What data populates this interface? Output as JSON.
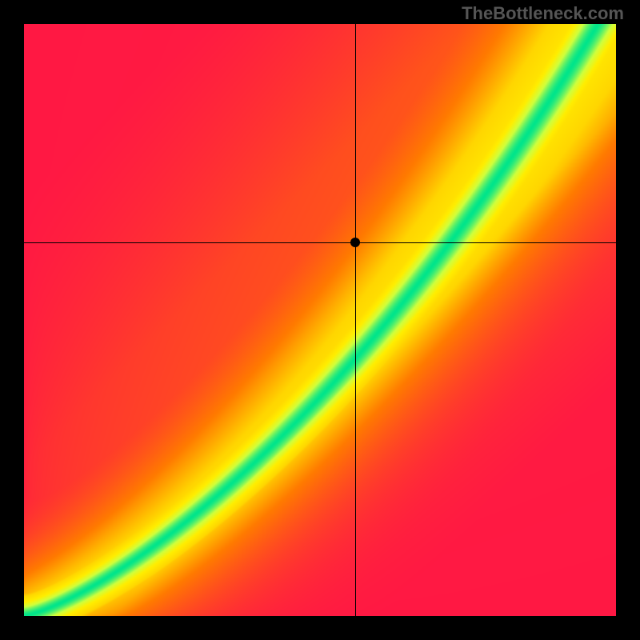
{
  "watermark": "TheBottleneck.com",
  "chart_data": {
    "type": "heatmap",
    "title": "",
    "xlabel": "",
    "ylabel": "",
    "xlim": [
      0,
      100
    ],
    "ylim": [
      0,
      100
    ],
    "crosshair": {
      "x": 56,
      "y": 63
    },
    "marker": {
      "x": 56,
      "y": 63
    },
    "color_stops": [
      {
        "value": 0.0,
        "color": "#ff1744"
      },
      {
        "value": 0.35,
        "color": "#ff7a00"
      },
      {
        "value": 0.55,
        "color": "#ffd600"
      },
      {
        "value": 0.72,
        "color": "#ffee00"
      },
      {
        "value": 0.85,
        "color": "#cfff3d"
      },
      {
        "value": 1.0,
        "color": "#00e58b"
      }
    ],
    "ridge_a": 1.05,
    "ridge_b": 0.6,
    "ridge_width_base": 0.045,
    "ridge_width_scale": 0.085,
    "bg_diagonal_bias": 0.35
  }
}
